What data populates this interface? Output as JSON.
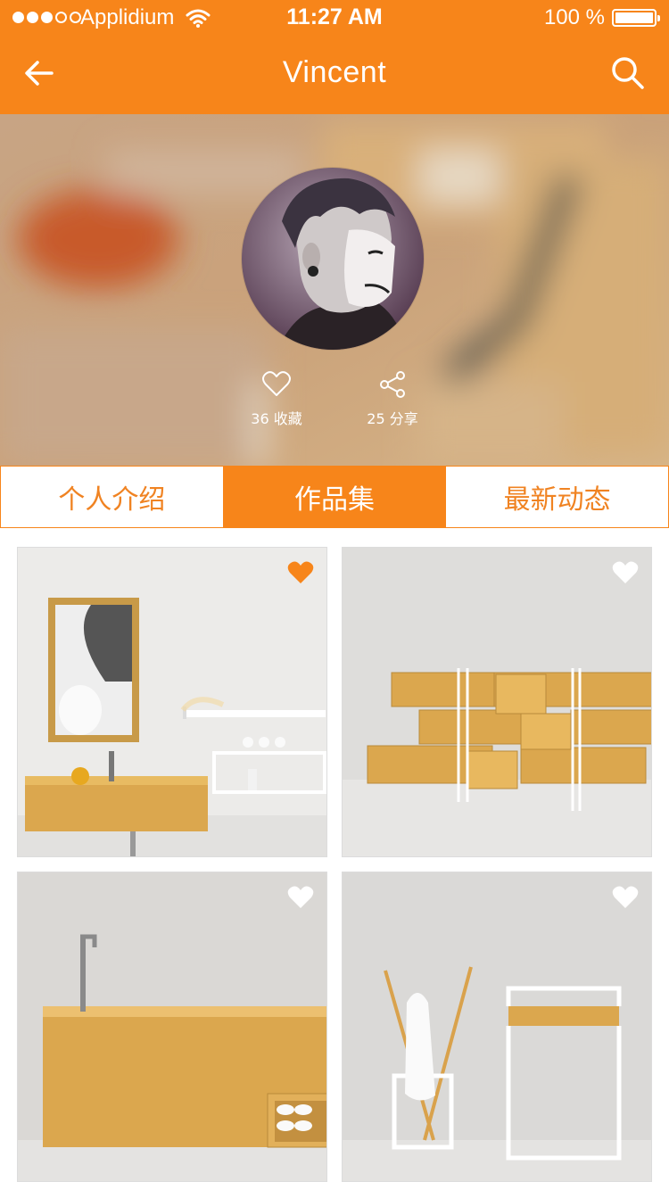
{
  "status_bar": {
    "carrier": "Applidium",
    "time": "11:27 AM",
    "battery": "100 %"
  },
  "nav": {
    "title": "Vincent",
    "back_icon": "arrow-left-icon",
    "search_icon": "search-icon"
  },
  "profile": {
    "favorites": "36 收藏",
    "shares": "25 分享"
  },
  "tabs": [
    {
      "label": "个人介绍",
      "active": false
    },
    {
      "label": "作品集",
      "active": true
    },
    {
      "label": "最新动态",
      "active": false
    }
  ],
  "works": [
    {
      "favorited": true
    },
    {
      "favorited": false
    },
    {
      "favorited": false
    },
    {
      "favorited": false
    }
  ],
  "colors": {
    "accent": "#f7851a",
    "wood": "#e2b35a"
  }
}
